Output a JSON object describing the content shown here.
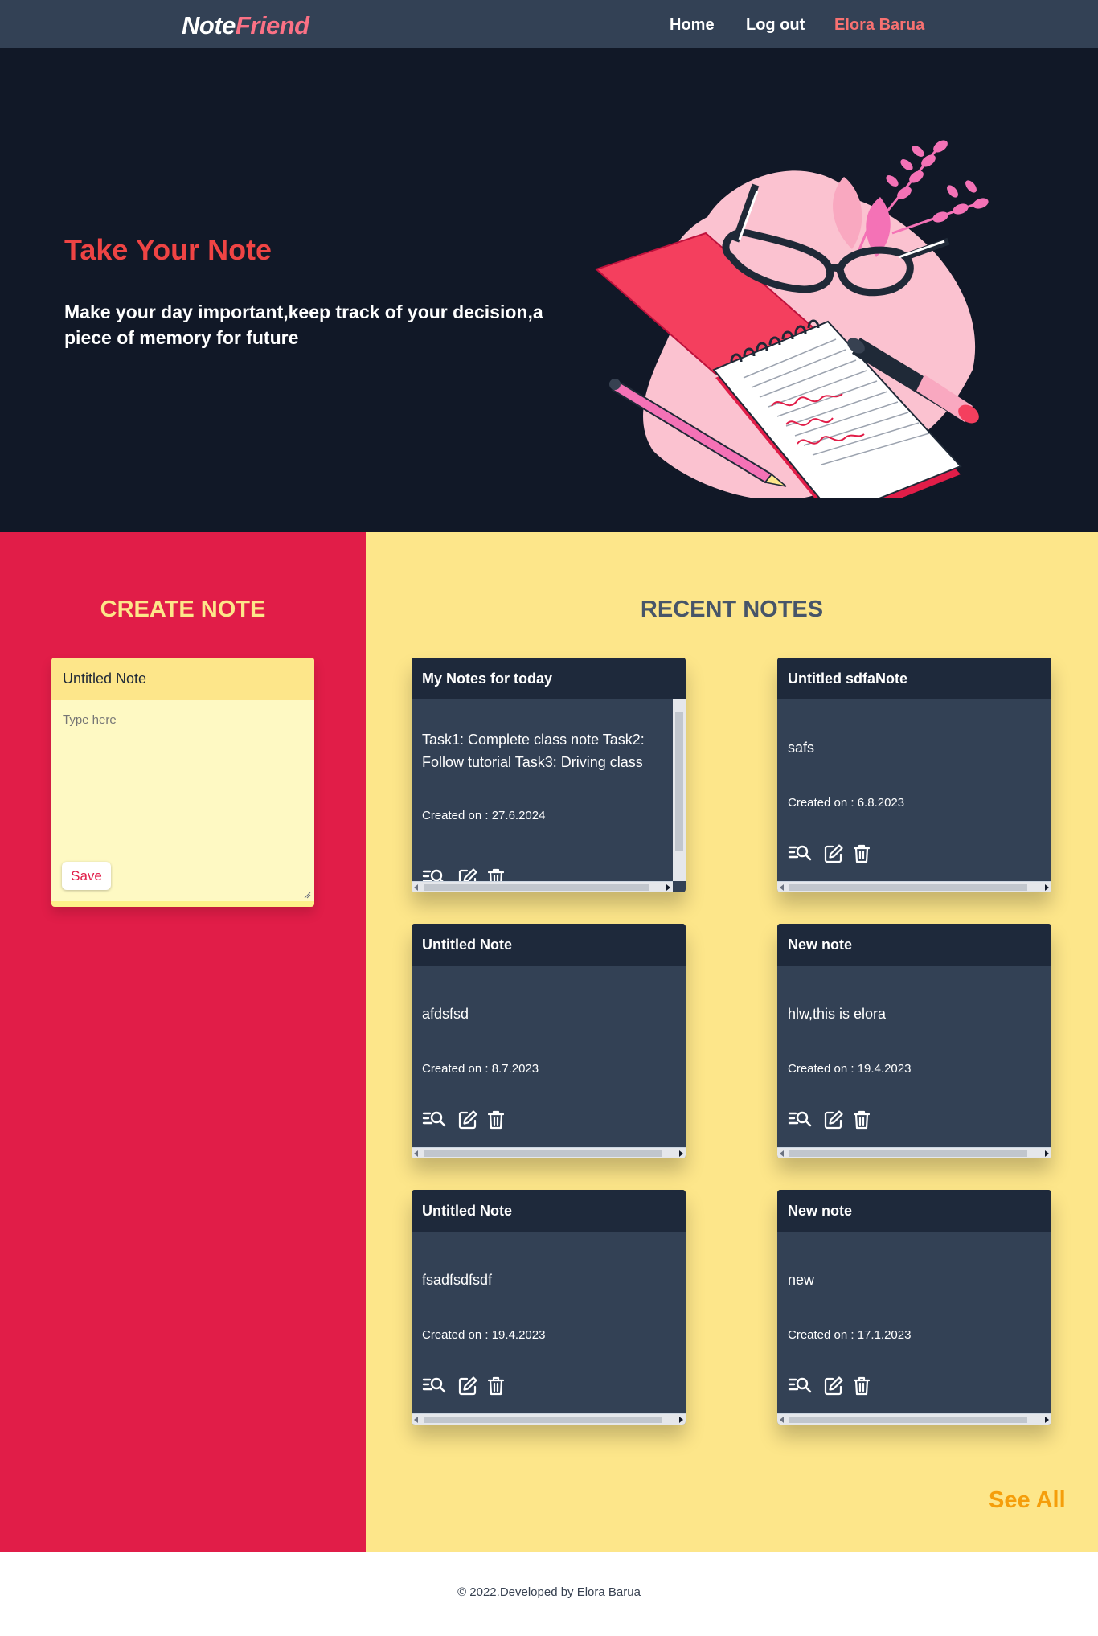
{
  "navbar": {
    "brand_part1": "Note",
    "brand_part2": "Friend",
    "links": [
      "Home",
      "Log out"
    ],
    "user": "Elora Barua"
  },
  "hero": {
    "title": "Take Your Note",
    "subtitle": "Make your day important,keep track of your decision,a piece of memory for future"
  },
  "create": {
    "heading": "CREATE NOTE",
    "title_value": "Untitled Note",
    "body_placeholder": "Type here",
    "save_label": "Save"
  },
  "recent": {
    "heading": "RECENT NOTES",
    "cards": [
      {
        "title": "My Notes for today",
        "body": "Task1: Complete class note Task2: Follow tutorial Task3: Driving class",
        "date": "Created on : 27.6.2024"
      },
      {
        "title": "Untitled sdfaNote",
        "body": "safs",
        "date": "Created on : 6.8.2023"
      },
      {
        "title": "Untitled Note",
        "body": "afdsfsd",
        "date": "Created on : 8.7.2023"
      },
      {
        "title": "New note",
        "body": "hlw,this is elora",
        "date": "Created on : 19.4.2023"
      },
      {
        "title": "Untitled Note",
        "body": "fsadfsdfsdf",
        "date": "Created on : 19.4.2023"
      },
      {
        "title": "New note",
        "body": "new",
        "date": "Created on : 17.1.2023"
      }
    ],
    "card_icons": [
      "view-icon",
      "edit-icon",
      "delete-icon"
    ],
    "see_all": "See All"
  },
  "footer": {
    "text": "© 2022.Developed by Elora Barua"
  },
  "colors": {
    "navbar": "#334155",
    "hero_bg": "#111827",
    "accent_red": "#e11d48",
    "yellow_bg": "#fde68a",
    "card_bg": "#334155",
    "card_head": "#1e293b",
    "see_all": "#f59e0b"
  }
}
